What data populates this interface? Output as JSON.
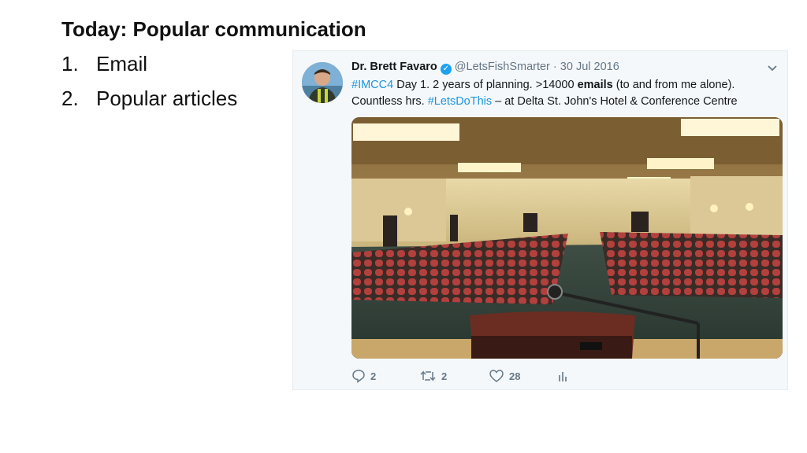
{
  "slide": {
    "title": "Today: Popular communication",
    "items": [
      {
        "num": "1.",
        "label": "Email"
      },
      {
        "num": "2.",
        "label": "Popular articles"
      }
    ]
  },
  "tweet": {
    "author_name": "Dr. Brett Favaro",
    "handle": "@LetsFishSmarter",
    "separator": "·",
    "date": "30 Jul 2016",
    "text": {
      "hashtag1": "#IMCC4",
      "part1": " Day 1. 2 years of planning. >14000 ",
      "bold": "emails",
      "part2": " (to and from me alone).",
      "part3": "Countless hrs. ",
      "hashtag2": "#LetsDoThis",
      "part4": " – at Delta St. John's Hotel & Conference Centre"
    },
    "stats": {
      "replies": "2",
      "retweets": "2",
      "likes": "28"
    },
    "icons": [
      "verified-icon",
      "chevron-down-icon",
      "reply-icon",
      "retweet-icon",
      "like-icon",
      "analytics-icon"
    ],
    "colors": {
      "link": "#1b95e0",
      "verified": "#1da1f2",
      "muted": "#657786",
      "text": "#14171a"
    }
  }
}
